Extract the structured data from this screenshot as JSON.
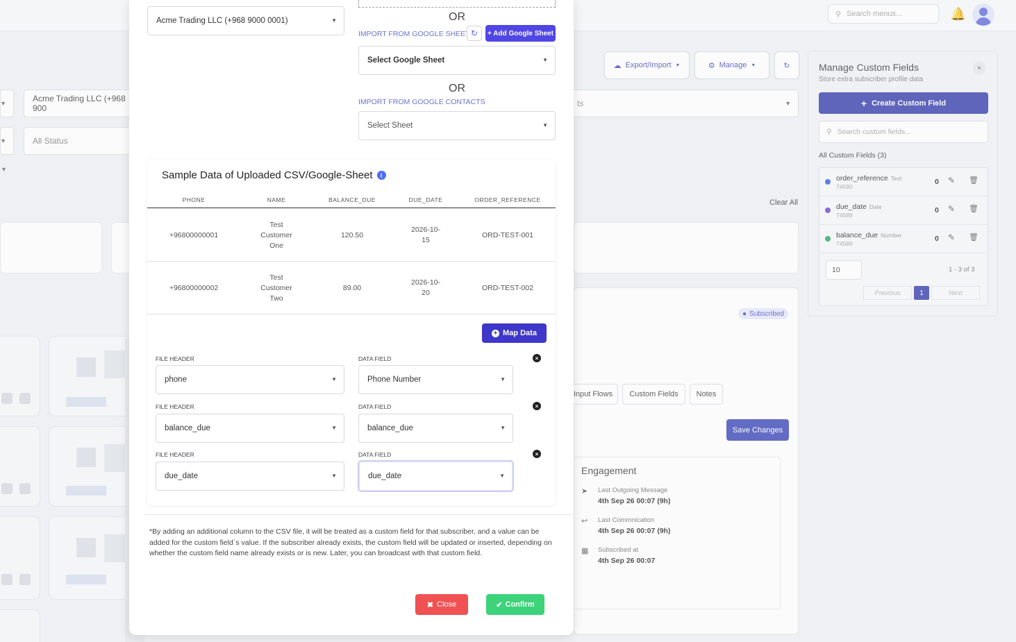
{
  "background": {
    "search_placeholder": "Search menus...",
    "export_import_label": "Export/Import",
    "manage_label": "Manage",
    "account_select": "Acme Trading LLC (+968 900",
    "status_select": "All Status",
    "hidden_select_suffix": "ts",
    "clear_all": "Clear All",
    "subscribed_badge": "Subscribed",
    "tabs": [
      "Input Flows",
      "Custom Fields",
      "Notes"
    ],
    "save_changes": "Save Changes",
    "engagement": {
      "title": "Engagement",
      "rows": [
        {
          "label": "Last Outgoing Message",
          "value": "4th Sep 26 00:07 (9h)"
        },
        {
          "label": "Last Commnication",
          "value": "4th Sep 26 00:07 (9h)"
        },
        {
          "label": "Subscribed at",
          "value": "4th Sep 26 00:07"
        }
      ]
    }
  },
  "custom_fields_panel": {
    "title": "Manage Custom Fields",
    "subtitle": "Store extra subscriber profile data",
    "close": "×",
    "create_label": "Create Custom Field",
    "search_placeholder": "Search custom fields...",
    "all_label": "All Custom Fields (3)",
    "fields": [
      {
        "name": "order_reference",
        "type": "Text",
        "id": "74590",
        "count": "0",
        "color": "#2f5bd8"
      },
      {
        "name": "due_date",
        "type": "Date",
        "id": "74589",
        "count": "0",
        "color": "#6b3fc9"
      },
      {
        "name": "balance_due",
        "type": "Number",
        "id": "74588",
        "count": "0",
        "color": "#20a35a"
      }
    ],
    "per_page": "10",
    "range": "1 - 3 of 3",
    "previous": "Previous",
    "page": "1",
    "next": "Next"
  },
  "modal": {
    "account_select": "Acme Trading LLC (+968 9000 0001)",
    "or_1": "OR",
    "import_google_sheet": "IMPORT FROM GOOGLE SHEET",
    "add_google_sheet": "+ Add Google Sheet",
    "select_google_sheet": "Select Google Sheet",
    "or_2": "OR",
    "import_google_contacts": "IMPORT FROM GOOGLE CONTACTS",
    "select_sheet": "Select Sheet",
    "sample_title": "Sample Data of Uploaded CSV/Google-Sheet",
    "table": {
      "headers": [
        "PHONE",
        "NAME",
        "BALANCE_DUE",
        "DUE_DATE",
        "ORDER_REFERENCE"
      ],
      "rows": [
        [
          "+96800000001",
          "Test Customer One",
          "120.50",
          "2026-10-15",
          "ORD-TEST-001"
        ],
        [
          "+96800000002",
          "Test Customer Two",
          "89.00",
          "2026-10-20",
          "ORD-TEST-002"
        ]
      ]
    },
    "map_data": "Map Data",
    "file_header_label": "FILE HEADER",
    "data_field_label": "DATA FIELD",
    "mappings": [
      {
        "file_header": "phone",
        "data_field": "Phone Number"
      },
      {
        "file_header": "balance_due",
        "data_field": "balance_due"
      },
      {
        "file_header": "due_date",
        "data_field": "due_date"
      }
    ],
    "note": "*By adding an additional column to the CSV file, it will be treated as a custom field for that subscriber, and a value can be added for the custom field`s value. If the subscriber already exists, the custom field will be updated or inserted, depending on whether the custom field name already exists or is new. Later, you can broadcast with that custom field.",
    "close_label": "Close",
    "confirm_label": "Confirm"
  }
}
